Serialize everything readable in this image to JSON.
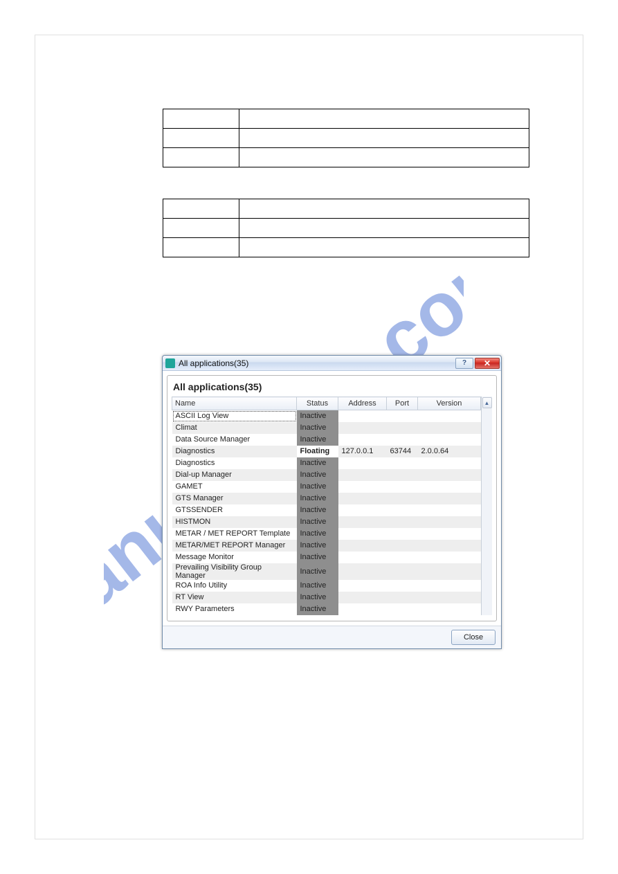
{
  "dialog": {
    "window_title": "All applications(35)",
    "panel_title": "All applications(35)",
    "help_label": "?",
    "close_label": "✕",
    "columns": {
      "name": "Name",
      "status": "Status",
      "address": "Address",
      "port": "Port",
      "version": "Version"
    },
    "rows": [
      {
        "name": "ASCII Log View",
        "status": "Inactive",
        "address": "",
        "port": "",
        "version": ""
      },
      {
        "name": "Climat",
        "status": "Inactive",
        "address": "",
        "port": "",
        "version": ""
      },
      {
        "name": "Data Source Manager",
        "status": "Inactive",
        "address": "",
        "port": "",
        "version": ""
      },
      {
        "name": "Diagnostics",
        "status": "Floating",
        "address": "127.0.0.1",
        "port": "63744",
        "version": "2.0.0.64"
      },
      {
        "name": "Diagnostics",
        "status": "Inactive",
        "address": "",
        "port": "",
        "version": ""
      },
      {
        "name": "Dial-up Manager",
        "status": "Inactive",
        "address": "",
        "port": "",
        "version": ""
      },
      {
        "name": "GAMET",
        "status": "Inactive",
        "address": "",
        "port": "",
        "version": ""
      },
      {
        "name": "GTS Manager",
        "status": "Inactive",
        "address": "",
        "port": "",
        "version": ""
      },
      {
        "name": "GTSSENDER",
        "status": "Inactive",
        "address": "",
        "port": "",
        "version": ""
      },
      {
        "name": "HISTMON",
        "status": "Inactive",
        "address": "",
        "port": "",
        "version": ""
      },
      {
        "name": "METAR / MET REPORT Template",
        "status": "Inactive",
        "address": "",
        "port": "",
        "version": ""
      },
      {
        "name": "METAR/MET REPORT Manager",
        "status": "Inactive",
        "address": "",
        "port": "",
        "version": ""
      },
      {
        "name": "Message Monitor",
        "status": "Inactive",
        "address": "",
        "port": "",
        "version": ""
      },
      {
        "name": "Prevailing Visibility Group Manager",
        "status": "Inactive",
        "address": "",
        "port": "",
        "version": ""
      },
      {
        "name": "ROA Info Utility",
        "status": "Inactive",
        "address": "",
        "port": "",
        "version": ""
      },
      {
        "name": "RT View",
        "status": "Inactive",
        "address": "",
        "port": "",
        "version": ""
      },
      {
        "name": "RWY Parameters",
        "status": "Inactive",
        "address": "",
        "port": "",
        "version": ""
      }
    ],
    "close_button": "Close"
  },
  "scroll": {
    "up": "▲",
    "down": "▼"
  }
}
